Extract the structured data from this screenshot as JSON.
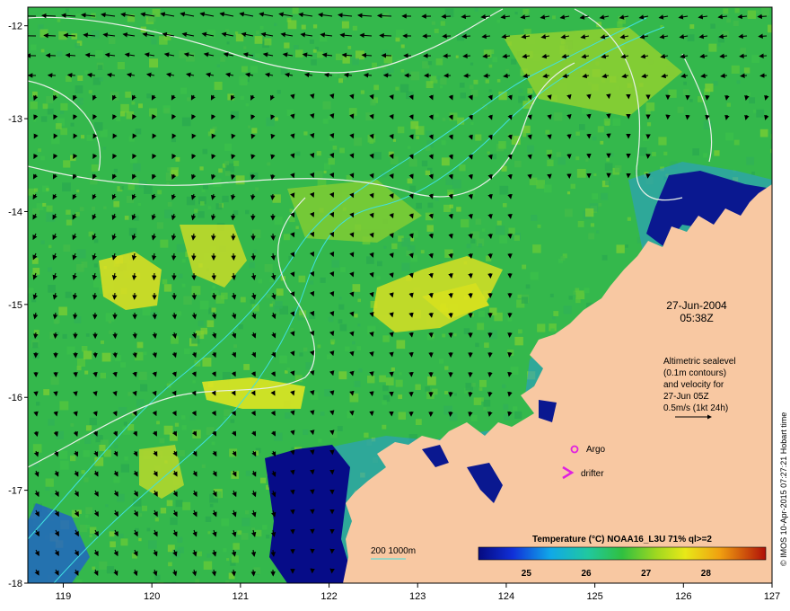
{
  "map": {
    "x_ticks": [
      "119",
      "120",
      "121",
      "122",
      "123",
      "124",
      "125",
      "126",
      "127"
    ],
    "y_ticks": [
      "-12",
      "-13",
      "-14",
      "-15",
      "-16",
      "-17",
      "-18"
    ],
    "lon_range": [
      118.6,
      127
    ],
    "lat_range": [
      -18,
      -11.8
    ],
    "date": "27-Jun-2004",
    "time": "05:38Z",
    "info_lines": [
      "Altimetric sealevel",
      "(0.1m contours)",
      "and velocity for",
      "27-Jun 05Z",
      "0.5m/s (1kt 24h)"
    ],
    "argo_label": "Argo",
    "drifter_label": "drifter",
    "bathy_label": "200  1000m",
    "credit": "© IMOS 10-Apr-2015 07:27:21 Hobart time"
  },
  "colorbar": {
    "title": "Temperature (°C) NOAA16_L3U 71% ql>=2",
    "ticks": [
      "25",
      "26",
      "27",
      "28"
    ],
    "range": [
      24.2,
      29.0
    ]
  },
  "colors": {
    "land": "#f7c8a0",
    "deep_cold": "#0a0f8c",
    "warm": "#e8e820",
    "sst_base": "#2fb84a",
    "argo": "#e020e0",
    "bathy": "#40e0e0",
    "contour": "#e8f0e8"
  }
}
